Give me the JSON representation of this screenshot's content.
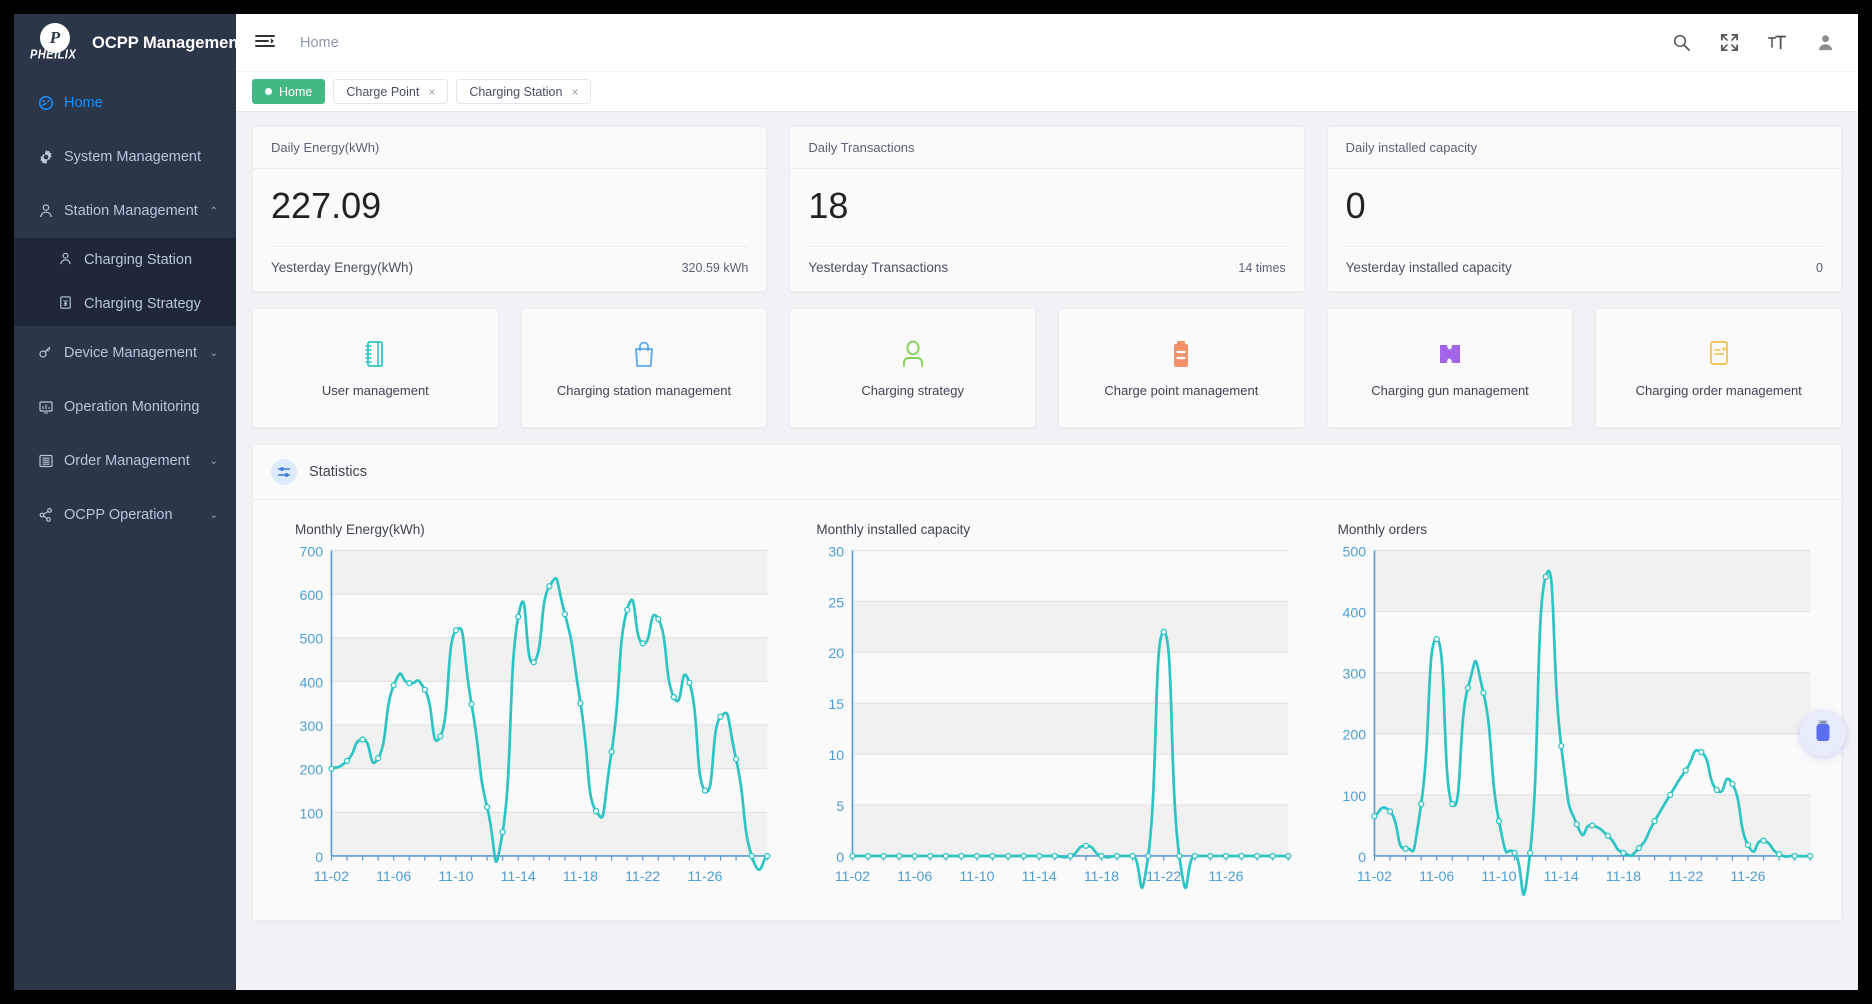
{
  "brand": {
    "logo_letter": "P",
    "logo_word": "PHEILIX",
    "title": "OCPP Management"
  },
  "sidebar": {
    "items": [
      {
        "label": "Home",
        "icon": "dashboard-icon",
        "active": true,
        "arrow": ""
      },
      {
        "label": "System Management",
        "icon": "gear-icon",
        "active": false,
        "arrow": ""
      },
      {
        "label": "Station Management",
        "icon": "station-user-icon",
        "active": false,
        "arrow": "⌃"
      },
      {
        "label": "Device Management",
        "icon": "device-icon",
        "active": false,
        "arrow": "⌄"
      },
      {
        "label": "Operation Monitoring",
        "icon": "monitor-icon",
        "active": false,
        "arrow": ""
      },
      {
        "label": "Order Management",
        "icon": "list-icon",
        "active": false,
        "arrow": "⌄"
      },
      {
        "label": "OCPP Operation",
        "icon": "share-nodes-icon",
        "active": false,
        "arrow": "⌄"
      }
    ],
    "submenu": [
      {
        "label": "Charging Station",
        "icon": "station-user-icon"
      },
      {
        "label": "Charging Strategy",
        "icon": "yen-document-icon"
      }
    ]
  },
  "topbar": {
    "menu_toggle_icon": "hamburger-collapse-icon",
    "breadcrumb": "Home",
    "icons": [
      {
        "name": "search-icon"
      },
      {
        "name": "fullscreen-icon"
      },
      {
        "name": "font-size-icon"
      },
      {
        "name": "user-avatar-icon"
      }
    ]
  },
  "tabs": [
    {
      "label": "Home",
      "active": true,
      "closable": false
    },
    {
      "label": "Charge Point",
      "active": false,
      "closable": true,
      "close": "×"
    },
    {
      "label": "Charging Station",
      "active": false,
      "closable": true,
      "close": "×"
    }
  ],
  "stat_cards": [
    {
      "title": "Daily Energy(kWh)",
      "value": "227.09",
      "foot_label": "Yesterday Energy(kWh)",
      "foot_value": "320.59 kWh"
    },
    {
      "title": "Daily Transactions",
      "value": "18",
      "foot_label": "Yesterday Transactions",
      "foot_value": "14 times"
    },
    {
      "title": "Daily installed capacity",
      "value": "0",
      "foot_label": "Yesterday installed capacity",
      "foot_value": "0"
    }
  ],
  "tiles": [
    {
      "label": "User management",
      "icon": "notebook-icon",
      "color": "#2ec6c6"
    },
    {
      "label": "Charging station management",
      "icon": "shopping-bag-icon",
      "color": "#5ba9f0"
    },
    {
      "label": "Charging strategy",
      "icon": "person-icon",
      "color": "#86d15a"
    },
    {
      "label": "Charge point management",
      "icon": "clipboard-icon",
      "color": "#f4906a"
    },
    {
      "label": "Charging gun management",
      "icon": "ticket-icon",
      "color": "#a365e8"
    },
    {
      "label": "Charging order management",
      "icon": "order-doc-icon",
      "color": "#f2c75c"
    }
  ],
  "statistics": {
    "badge_icon": "sliders-icon",
    "title": "Statistics"
  },
  "float_button": {
    "icon": "usb-drive-icon"
  },
  "chart_data": [
    {
      "type": "line",
      "title": "Monthly Energy(kWh)",
      "xlabel": "",
      "ylabel": "",
      "ylim": [
        0,
        700
      ],
      "yticks": [
        0,
        100,
        200,
        300,
        400,
        500,
        600,
        700
      ],
      "grid": true,
      "line_color": "#2ec4c4",
      "tick_labels": [
        "11-02",
        "11-06",
        "11-10",
        "11-14",
        "11-18",
        "11-22",
        "11-26"
      ],
      "x": [
        "11-02",
        "11-03",
        "11-04",
        "11-05",
        "11-06",
        "11-07",
        "11-08",
        "11-09",
        "11-10",
        "11-11",
        "11-12",
        "11-13",
        "11-14",
        "11-15",
        "11-16",
        "11-17",
        "11-18",
        "11-19",
        "11-20",
        "11-21",
        "11-22",
        "11-23",
        "11-24",
        "11-25",
        "11-26",
        "11-27",
        "11-28",
        "11-29",
        "11-30"
      ],
      "values": [
        200,
        218,
        267,
        224,
        391,
        396,
        381,
        274,
        517,
        348,
        112,
        55,
        548,
        444,
        618,
        554,
        350,
        103,
        239,
        564,
        487,
        543,
        364,
        397,
        150,
        319,
        222,
        0,
        0
      ]
    },
    {
      "type": "line",
      "title": "Monthly installed capacity",
      "xlabel": "",
      "ylabel": "",
      "ylim": [
        0,
        30
      ],
      "yticks": [
        0,
        5,
        10,
        15,
        20,
        25,
        30
      ],
      "grid": true,
      "line_color": "#2ec4c4",
      "tick_labels": [
        "11-02",
        "11-06",
        "11-10",
        "11-14",
        "11-18",
        "11-22",
        "11-26"
      ],
      "x": [
        "11-02",
        "11-03",
        "11-04",
        "11-05",
        "11-06",
        "11-07",
        "11-08",
        "11-09",
        "11-10",
        "11-11",
        "11-12",
        "11-13",
        "11-14",
        "11-15",
        "11-16",
        "11-17",
        "11-18",
        "11-19",
        "11-20",
        "11-21",
        "11-22",
        "11-23",
        "11-24",
        "11-25",
        "11-26",
        "11-27",
        "11-28",
        "11-29",
        "11-30"
      ],
      "values": [
        0,
        0,
        0,
        0,
        0,
        0,
        0,
        0,
        0,
        0,
        0,
        0,
        0,
        0,
        0,
        1,
        0,
        0,
        0,
        0,
        22,
        0,
        0,
        0,
        0,
        0,
        0,
        0,
        0
      ]
    },
    {
      "type": "line",
      "title": "Monthly orders",
      "xlabel": "",
      "ylabel": "",
      "ylim": [
        0,
        500
      ],
      "yticks": [
        0,
        100,
        200,
        300,
        400,
        500
      ],
      "grid": true,
      "line_color": "#2ec4c4",
      "tick_labels": [
        "11-02",
        "11-06",
        "11-10",
        "11-14",
        "11-18",
        "11-22",
        "11-26"
      ],
      "x": [
        "11-02",
        "11-03",
        "11-04",
        "11-05",
        "11-06",
        "11-07",
        "11-08",
        "11-09",
        "11-10",
        "11-11",
        "11-12",
        "11-13",
        "11-14",
        "11-15",
        "11-16",
        "11-17",
        "11-18",
        "11-19",
        "11-20",
        "11-21",
        "11-22",
        "11-23",
        "11-24",
        "11-25",
        "11-26",
        "11-27",
        "11-28",
        "11-29",
        "11-30"
      ],
      "values": [
        65,
        73,
        12,
        85,
        355,
        85,
        275,
        267,
        57,
        5,
        5,
        457,
        180,
        52,
        50,
        33,
        5,
        13,
        57,
        100,
        140,
        170,
        108,
        118,
        18,
        25,
        3,
        0,
        0
      ]
    }
  ]
}
